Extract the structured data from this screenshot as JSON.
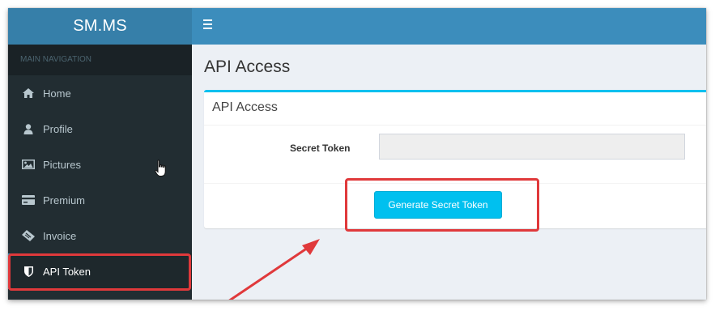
{
  "app": {
    "logo": "SM.MS"
  },
  "sidebar": {
    "header": "MAIN NAVIGATION",
    "items": [
      {
        "label": "Home",
        "icon": "home-icon"
      },
      {
        "label": "Profile",
        "icon": "user-icon"
      },
      {
        "label": "Pictures",
        "icon": "image-icon"
      },
      {
        "label": "Premium",
        "icon": "credit-card-icon"
      },
      {
        "label": "Invoice",
        "icon": "ticket-icon"
      },
      {
        "label": "API Token",
        "icon": "shield-icon",
        "active": true
      }
    ]
  },
  "page": {
    "title": "API Access",
    "box_title": "API Access",
    "secret_token_label": "Secret Token",
    "secret_token_value": "",
    "generate_button_label": "Generate Secret Token"
  },
  "colors": {
    "brand_dark": "#367fa9",
    "brand": "#3c8dbc",
    "sidebar_bg": "#222d32",
    "info": "#00c0ef",
    "annotation_red": "#e0393b"
  }
}
